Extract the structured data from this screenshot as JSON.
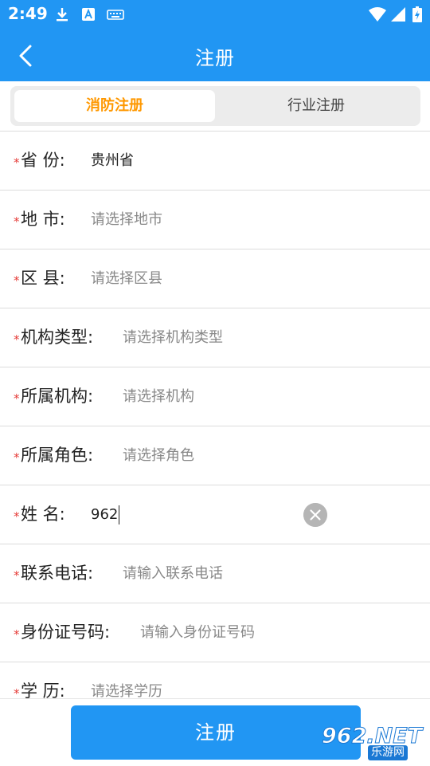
{
  "status_bar": {
    "time": "2:49",
    "icons": [
      "download-icon",
      "font-a-icon",
      "keyboard-icon",
      "wifi-icon",
      "signal-icon",
      "battery-icon"
    ]
  },
  "app_bar": {
    "title": "注册",
    "back_icon": "chevron-left-icon"
  },
  "tabs": [
    {
      "label": "消防注册",
      "active": true
    },
    {
      "label": "行业注册",
      "active": false
    }
  ],
  "form": {
    "required_mark": "*",
    "fields": [
      {
        "label": "省 份:",
        "value": "贵州省",
        "placeholder": ""
      },
      {
        "label": "地 市:",
        "value": "",
        "placeholder": "请选择地市"
      },
      {
        "label": "区 县:",
        "value": "",
        "placeholder": "请选择区县"
      },
      {
        "label": "机构类型:",
        "value": "",
        "placeholder": "请选择机构类型"
      },
      {
        "label": "所属机构:",
        "value": "",
        "placeholder": "请选择机构"
      },
      {
        "label": "所属角色:",
        "value": "",
        "placeholder": "请选择角色"
      },
      {
        "label": "姓 名:",
        "value": "962",
        "placeholder": ""
      },
      {
        "label": "联系电话:",
        "value": "",
        "placeholder": "请输入联系电话"
      },
      {
        "label": "身份证号码:",
        "value": "",
        "placeholder": "请输入身份证号码"
      },
      {
        "label": "学 历:",
        "value": "",
        "placeholder": "请选择学历"
      }
    ]
  },
  "footer": {
    "submit_label": "注册"
  },
  "watermark": {
    "brand": "962.NET",
    "sub": "乐游网"
  },
  "colors": {
    "primary": "#2196f3",
    "active_tab": "#ff9800",
    "required": "#e53935",
    "placeholder": "#888888"
  }
}
